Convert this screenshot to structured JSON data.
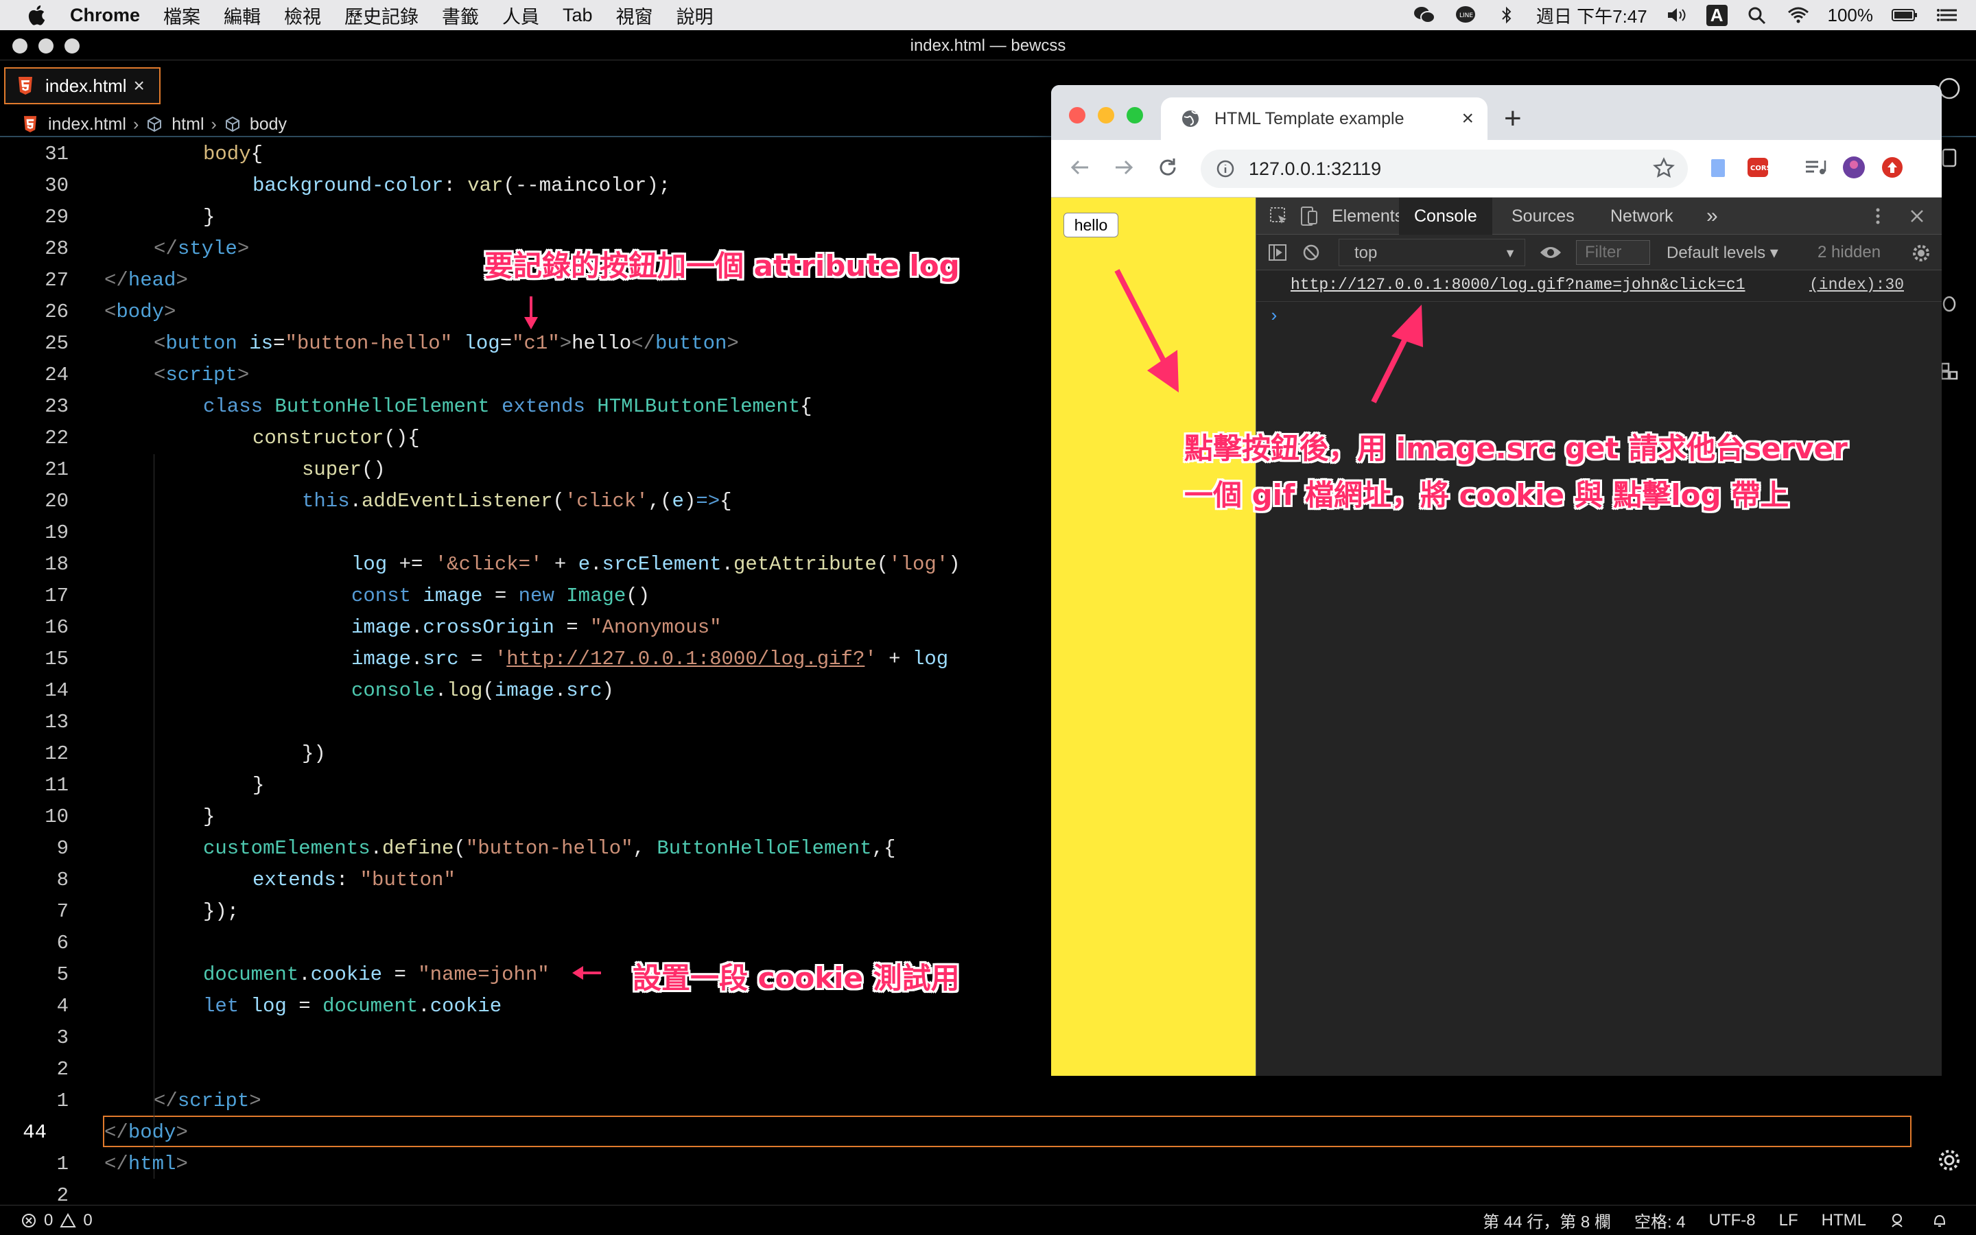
{
  "menubar": {
    "app": "Chrome",
    "items": [
      "檔案",
      "編輯",
      "檢視",
      "歷史記錄",
      "書籤",
      "人員",
      "Tab",
      "視窗",
      "說明"
    ],
    "clock": "週日 下午7:47",
    "battery": "100%",
    "input_method": "A"
  },
  "vscode": {
    "window_title": "index.html — bewcss",
    "tab_label": "index.html",
    "breadcrumb": [
      "index.html",
      "html",
      "body"
    ],
    "lines": [
      {
        "n": "31"
      },
      {
        "n": "30"
      },
      {
        "n": "29"
      },
      {
        "n": "28"
      },
      {
        "n": "27"
      },
      {
        "n": "26"
      },
      {
        "n": "25"
      },
      {
        "n": "24"
      },
      {
        "n": "23"
      },
      {
        "n": "22"
      },
      {
        "n": "21"
      },
      {
        "n": "20"
      },
      {
        "n": "19"
      },
      {
        "n": "18"
      },
      {
        "n": "17"
      },
      {
        "n": "16"
      },
      {
        "n": "15"
      },
      {
        "n": "14"
      },
      {
        "n": "13"
      },
      {
        "n": "12"
      },
      {
        "n": "11"
      },
      {
        "n": "10"
      },
      {
        "n": "9"
      },
      {
        "n": "8"
      },
      {
        "n": "7"
      },
      {
        "n": "6"
      },
      {
        "n": "5"
      },
      {
        "n": "4"
      },
      {
        "n": "3"
      },
      {
        "n": "2"
      },
      {
        "n": "1"
      },
      {
        "n": "44"
      },
      {
        "n": "1"
      },
      {
        "n": "2"
      }
    ],
    "code": {
      "l31_sel": "body",
      "l31_brace": "{",
      "l30_prop": "background-color",
      "l30_colon": ": ",
      "l30_fn": "var",
      "l30_arg": "(--maincolor);",
      "l29": "}",
      "l28_open": "</",
      "l28_tag": "style",
      "l28_close": ">",
      "l27_open": "</",
      "l27_tag": "head",
      "l27_close": ">",
      "l26_open": "<",
      "l26_tag": "body",
      "l26_close": ">",
      "l25_open": "<",
      "l25_tag": "button",
      "l25_attr1": " is",
      "l25_eq1": "=",
      "l25_val1": "\"button-hello\"",
      "l25_attr2": " log",
      "l25_eq2": "=",
      "l25_val2": "\"c1\"",
      "l25_gt": ">",
      "l25_text": "hello",
      "l25_end_open": "</",
      "l25_end_tag": "button",
      "l25_end_close": ">",
      "l24_open": "<",
      "l24_tag": "script",
      "l24_close": ">",
      "l23_kw": "class",
      "l23_cls": " ButtonHelloElement",
      "l23_kw2": " extends",
      "l23_cls2": " HTMLButtonElement",
      "l23_brace": "{",
      "l22_fn": "constructor",
      "l22_rest": "(){",
      "l21_fn": "super",
      "l21_rest": "()",
      "l20_this": "this",
      "l20_dot": ".",
      "l20_fn": "addEventListener",
      "l20_p1": "(",
      "l20_str": "'click'",
      "l20_p2": ",(",
      "l20_e": "e",
      "l20_p3": ")",
      "l20_arrow": "=>",
      "l20_brace": "{",
      "l18_var": "log",
      "l18_op": " += ",
      "l18_str": "'&click='",
      "l18_plus": " + ",
      "l18_e": "e",
      "l18_dot1": ".",
      "l18_prop": "srcElement",
      "l18_dot2": ".",
      "l18_fn": "getAttribute",
      "l18_p1": "(",
      "l18_str2": "'log'",
      "l18_p2": ")",
      "l17_kw": "const",
      "l17_var": " image",
      "l17_eq": " = ",
      "l17_new": "new",
      "l17_cls": " Image",
      "l17_rest": "()",
      "l16_var": "image",
      "l16_dot": ".",
      "l16_prop": "crossOrigin",
      "l16_eq": " = ",
      "l16_str": "\"Anonymous\"",
      "l15_var": "image",
      "l15_dot": ".",
      "l15_prop": "src",
      "l15_eq": " = ",
      "l15_q1": "'",
      "l15_url": "http://127.0.0.1:8000/log.gif?",
      "l15_q2": "'",
      "l15_plus": " + ",
      "l15_log": "log",
      "l14_obj": "console",
      "l14_dot": ".",
      "l14_fn": "log",
      "l14_p1": "(",
      "l14_var": "image",
      "l14_dot2": ".",
      "l14_prop": "src",
      "l14_p2": ")",
      "l12": "})",
      "l11": "}",
      "l10": "}",
      "l9_obj": "customElements",
      "l9_dot": ".",
      "l9_fn": "define",
      "l9_p1": "(",
      "l9_str": "\"button-hello\"",
      "l9_comma": ", ",
      "l9_cls": "ButtonHelloElement",
      "l9_rest": ",{",
      "l8_key": "extends",
      "l8_colon": ": ",
      "l8_str": "\"button\"",
      "l7": "});",
      "l5_obj": "document",
      "l5_dot": ".",
      "l5_prop": "cookie",
      "l5_eq": " = ",
      "l5_str": "\"name=john\"",
      "l4_kw": "let",
      "l4_var": " log",
      "l4_eq": " = ",
      "l4_obj": "document",
      "l4_dot": ".",
      "l4_prop": "cookie",
      "l1_open": "</",
      "l1_tag": "script",
      "l1_close": ">",
      "l44_open": "</",
      "l44_tag": "body",
      "l44_close": ">",
      "l1b_open": "</",
      "l1b_tag": "html",
      "l1b_close": ">"
    },
    "status": {
      "errors": "0",
      "warnings": "0",
      "position": "第 44 行，第 8 欄",
      "spaces": "空格: 4",
      "encoding": "UTF-8",
      "eol": "LF",
      "language": "HTML"
    }
  },
  "annotations": {
    "attribute_note": "要記錄的按鈕加一個 attribute log",
    "cookie_note": "設置一段 cookie 測試用",
    "click_note_line1": "點擊按鈕後，用 image.src get 請求他台server",
    "click_note_line2": "一個 gif 檔網址，將 cookie 與 點擊log 帶上"
  },
  "chrome": {
    "tab_title": "HTML Template example",
    "url": "127.0.0.1:32119",
    "page_button": "hello",
    "devtools": {
      "tabs": [
        "Elements",
        "Console",
        "Sources",
        "Network"
      ],
      "active_tab": "Console",
      "more": "»",
      "context": "top",
      "filter_placeholder": "Filter",
      "levels": "Default levels ▾",
      "hidden": "2 hidden",
      "log_url": "http://127.0.0.1:8000/log.gif?name=john&click=c1",
      "log_source": "(index):30",
      "prompt": "›"
    },
    "colors": {
      "page_bg": "#ffeb3b",
      "devtools_bg": "#242424"
    }
  },
  "colors": {
    "accent": "#e07a2c",
    "annotation": "#ff2d6a"
  }
}
